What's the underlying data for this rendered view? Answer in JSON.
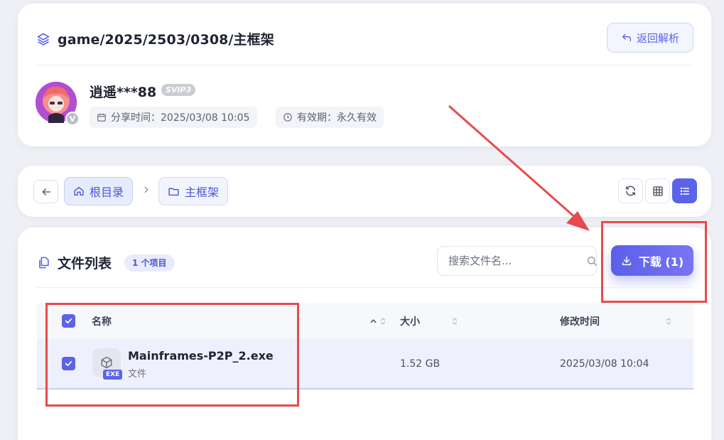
{
  "share": {
    "path": "game/2025/2503/0308/主框架",
    "back_label": "返回解析",
    "user_name": "逍遥***88",
    "vip_badge": "SVIP3",
    "avatar_badge": "V",
    "share_time": "分享时间：2025/03/08 10:05",
    "validity": "有效期：永久有效"
  },
  "nav": {
    "root_label": "根目录",
    "current_label": "主框架"
  },
  "file_list": {
    "title": "文件列表",
    "count_badge": "1 个项目",
    "search_placeholder": "搜索文件名...",
    "download_label": "下载 (1)",
    "columns": {
      "name": "名称",
      "size": "大小",
      "modified": "修改时间"
    },
    "rows": [
      {
        "name": "Mainframes-P2P_2.exe",
        "ext": "EXE",
        "type": "文件",
        "size": "1.52 GB",
        "modified": "2025/03/08 10:04",
        "selected": true
      }
    ]
  },
  "colors": {
    "accent": "#5b63e8",
    "annotation": "#e84b4b",
    "page_bg": "#eef0f5"
  },
  "icons": {
    "path": "layers-icon",
    "back": "undo-arrow-icon",
    "calendar": "calendar-icon",
    "clock": "clock-icon",
    "home": "home-icon",
    "folder": "folder-icon",
    "refresh": "refresh-icon",
    "grid": "grid-view-icon",
    "list": "list-view-icon",
    "files": "files-icon",
    "search": "search-icon",
    "download": "download-icon",
    "file": "package-icon"
  }
}
